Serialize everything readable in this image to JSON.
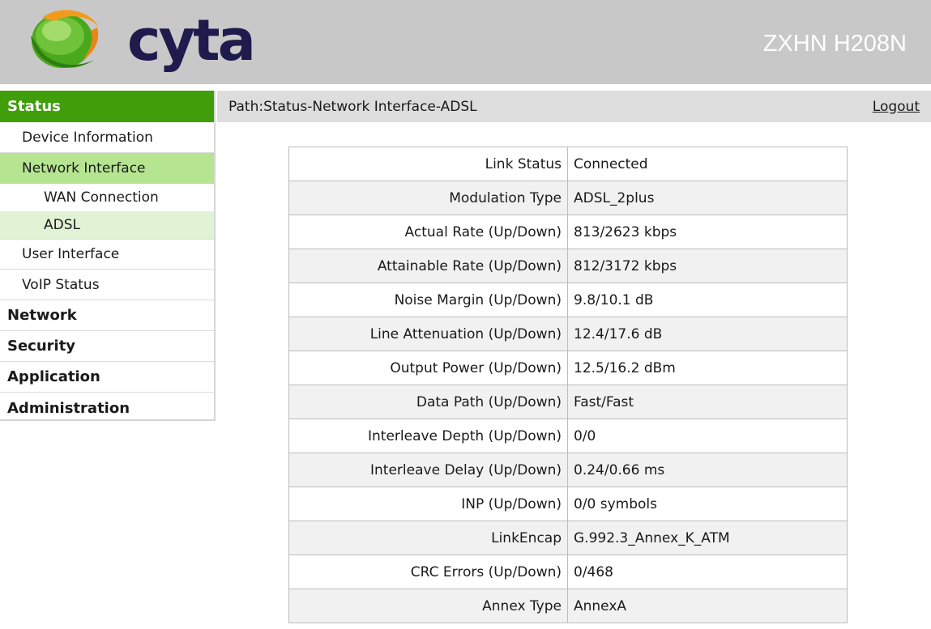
{
  "header": {
    "brand": "cyta",
    "model": "ZXHN H208N",
    "colors": {
      "brand_text": "#1f1b4d",
      "logo_green": "#3f9e0a",
      "logo_orange": "#f39a1b"
    }
  },
  "path": {
    "text": "Path:Status-Network Interface-ADSL",
    "logout": "Logout"
  },
  "nav": {
    "status": "Status",
    "device_information": "Device Information",
    "network_interface": "Network Interface",
    "wan_connection": "WAN Connection",
    "adsl": "ADSL",
    "user_interface": "User Interface",
    "voip_status": "VoIP Status",
    "network": "Network",
    "security": "Security",
    "application": "Application",
    "administration": "Administration"
  },
  "rows": [
    {
      "label": "Link Status",
      "value": "Connected"
    },
    {
      "label": "Modulation Type",
      "value": "ADSL_2plus"
    },
    {
      "label": "Actual Rate (Up/Down)",
      "value": "813/2623 kbps"
    },
    {
      "label": "Attainable Rate (Up/Down)",
      "value": "812/3172 kbps"
    },
    {
      "label": "Noise Margin (Up/Down)",
      "value": "9.8/10.1 dB"
    },
    {
      "label": "Line Attenuation (Up/Down)",
      "value": "12.4/17.6 dB"
    },
    {
      "label": "Output Power (Up/Down)",
      "value": "12.5/16.2 dBm"
    },
    {
      "label": "Data Path (Up/Down)",
      "value": "Fast/Fast"
    },
    {
      "label": "Interleave Depth (Up/Down)",
      "value": "0/0"
    },
    {
      "label": "Interleave Delay (Up/Down)",
      "value": "0.24/0.66 ms"
    },
    {
      "label": "INP (Up/Down)",
      "value": "0/0 symbols"
    },
    {
      "label": "LinkEncap",
      "value": "G.992.3_Annex_K_ATM"
    },
    {
      "label": "CRC Errors (Up/Down)",
      "value": "0/468"
    },
    {
      "label": "Annex Type",
      "value": "AnnexA"
    }
  ]
}
